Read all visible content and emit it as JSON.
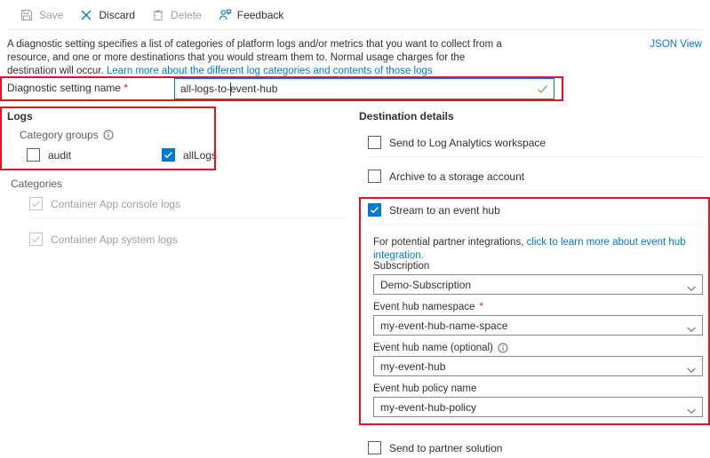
{
  "toolbar": {
    "items": [
      {
        "label": "Save",
        "icon": "save-icon",
        "enabled": false
      },
      {
        "label": "Discard",
        "icon": "discard-icon",
        "enabled": true
      },
      {
        "label": "Delete",
        "icon": "delete-icon",
        "enabled": false
      },
      {
        "label": "Feedback",
        "icon": "feedback-icon",
        "enabled": true
      }
    ]
  },
  "intro": {
    "text": "A diagnostic setting specifies a list of categories of platform logs and/or metrics that you want to collect from a resource, and one or more destinations that you would stream them to. Normal usage charges for the destination will occur. ",
    "link_text": "Learn more about the different log categories and contents of those logs",
    "json_view_label": "JSON View"
  },
  "setting_name": {
    "label": "Diagnostic setting name",
    "required_marker": "*",
    "value": "all-logs-to-event-hub",
    "placeholder": "",
    "validation_icon": "green-check-icon"
  },
  "logs": {
    "title": "Logs",
    "category_groups_label": "Category groups",
    "category_groups_info_icon": "info-icon",
    "groups": [
      {
        "label": "audit",
        "checked": false,
        "disabled": false
      },
      {
        "label": "allLogs",
        "checked": true,
        "disabled": false
      }
    ],
    "categories_label": "Categories",
    "categories": [
      {
        "label": "Container App console logs",
        "checked": true,
        "disabled": true
      },
      {
        "label": "Container App system logs",
        "checked": true,
        "disabled": true
      }
    ]
  },
  "destination": {
    "title": "Destination details",
    "log_analytics": {
      "label": "Send to Log Analytics workspace",
      "checked": false
    },
    "storage": {
      "label": "Archive to a storage account",
      "checked": false
    },
    "event_hub": {
      "label": "Stream to an event hub",
      "checked": true
    },
    "partner": {
      "label": "Send to partner solution",
      "checked": false
    },
    "partner_note": {
      "text": "For potential partner integrations, ",
      "link_text": "click to learn more about event hub integration."
    },
    "fields": [
      {
        "label": "Subscription",
        "required": false,
        "info_icon": null,
        "value": "Demo-Subscription"
      },
      {
        "label": "Event hub namespace",
        "required": true,
        "info_icon": null,
        "value": "my-event-hub-name-space"
      },
      {
        "label": "Event hub name (optional)",
        "required": false,
        "info_icon": "info-icon",
        "value": "my-event-hub"
      },
      {
        "label": "Event hub policy name",
        "required": false,
        "info_icon": null,
        "value": "my-event-hub-policy"
      }
    ]
  },
  "annotations": {
    "highlight_color": "#e81123",
    "boxes": [
      {
        "name": "diagnostic-setting-name"
      },
      {
        "name": "logs-category-groups"
      },
      {
        "name": "stream-to-event-hub"
      }
    ]
  },
  "colors": {
    "accent": "#0078d4",
    "required": "#e81123",
    "disabled_text": "#a19f9d",
    "body_text": "#323130"
  }
}
